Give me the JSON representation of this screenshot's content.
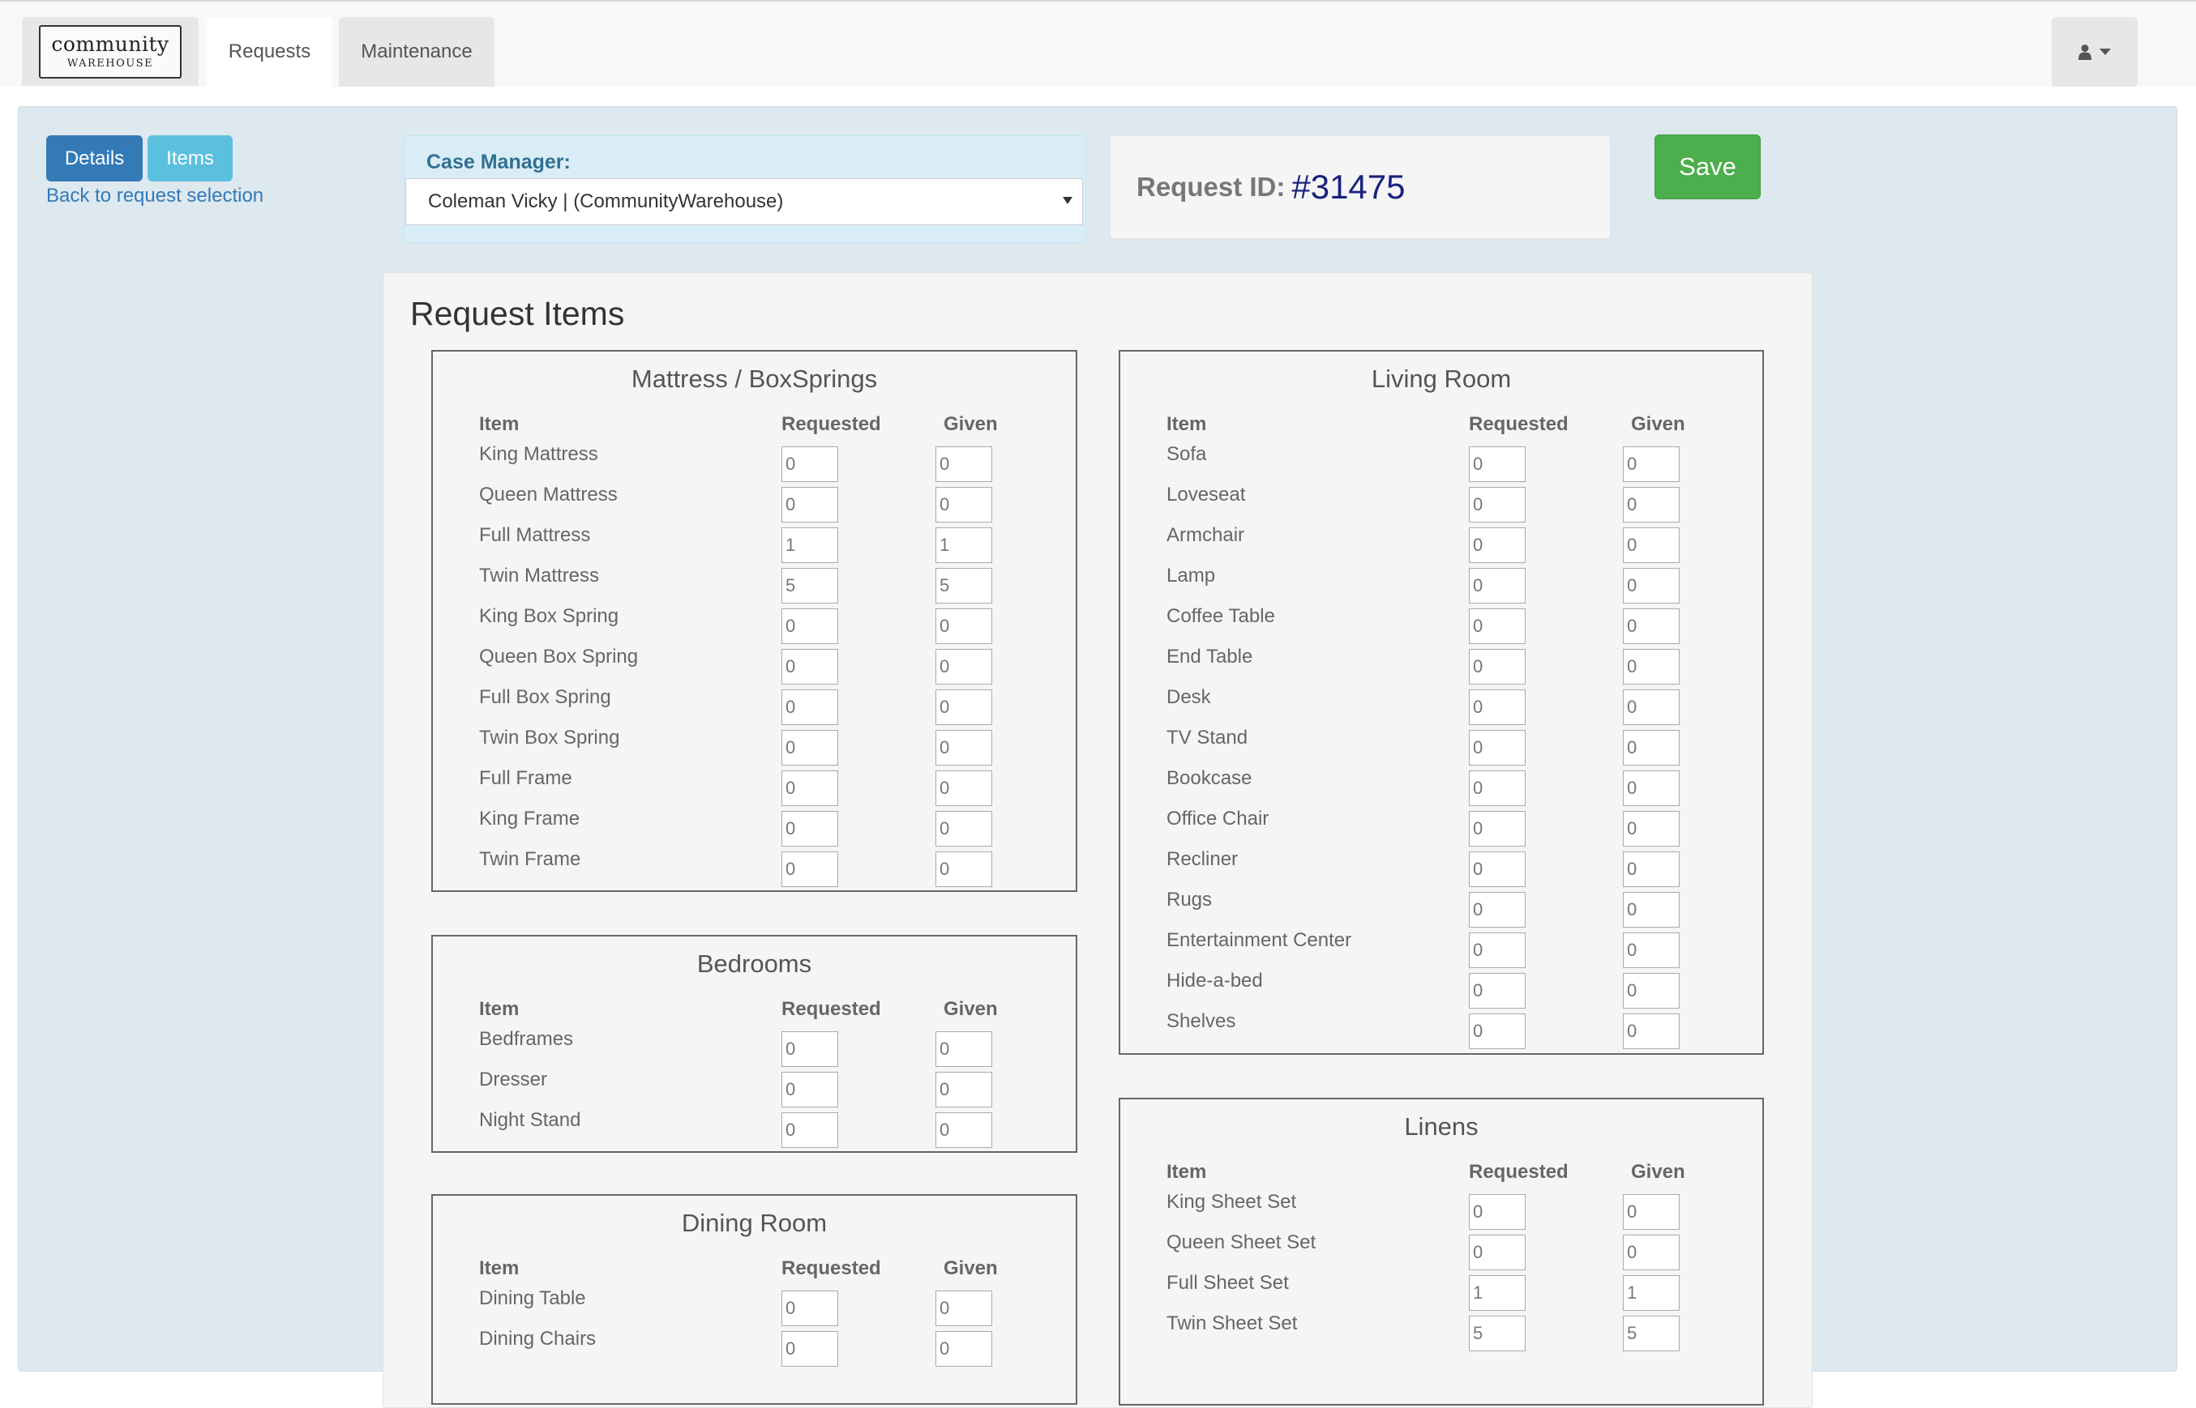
{
  "brand": {
    "logo_line1": "community",
    "logo_line2": "warehouse"
  },
  "nav": {
    "tabs": [
      {
        "label": "Requests"
      },
      {
        "label": "Maintenance"
      }
    ],
    "user_icon": "user-icon",
    "caret_icon": "caret-down-icon"
  },
  "subnav": {
    "details_label": "Details",
    "items_label": "Items",
    "back_link": "Back to request selection"
  },
  "case_manager": {
    "label": "Case Manager:",
    "selected": "Coleman Vicky | (CommunityWarehouse)"
  },
  "request": {
    "id_label": "Request ID:",
    "id_value": "#31475"
  },
  "save_label": "Save",
  "items_title": "Request Items",
  "columns": {
    "item": "Item",
    "requested": "Requested",
    "given": "Given"
  },
  "colors": {
    "primary": "#337ab7",
    "info": "#5bc0de",
    "success": "#4cae4c",
    "panel": "#dde8ef",
    "request_id": "#1a237e"
  },
  "categories": [
    {
      "title": "Mattress / BoxSprings",
      "rows": [
        {
          "name": "King Mattress",
          "requested": "0",
          "given": "0"
        },
        {
          "name": "Queen Mattress",
          "requested": "0",
          "given": "0"
        },
        {
          "name": "Full Mattress",
          "requested": "1",
          "given": "1"
        },
        {
          "name": "Twin Mattress",
          "requested": "5",
          "given": "5"
        },
        {
          "name": "King Box Spring",
          "requested": "0",
          "given": "0"
        },
        {
          "name": "Queen Box Spring",
          "requested": "0",
          "given": "0"
        },
        {
          "name": "Full Box Spring",
          "requested": "0",
          "given": "0"
        },
        {
          "name": "Twin Box Spring",
          "requested": "0",
          "given": "0"
        },
        {
          "name": "Full Frame",
          "requested": "0",
          "given": "0"
        },
        {
          "name": "King Frame",
          "requested": "0",
          "given": "0"
        },
        {
          "name": "Twin Frame",
          "requested": "0",
          "given": "0"
        }
      ]
    },
    {
      "title": "Bedrooms",
      "rows": [
        {
          "name": "Bedframes",
          "requested": "0",
          "given": "0"
        },
        {
          "name": "Dresser",
          "requested": "0",
          "given": "0"
        },
        {
          "name": "Night Stand",
          "requested": "0",
          "given": "0"
        }
      ]
    },
    {
      "title": "Dining Room",
      "rows": [
        {
          "name": "Dining Table",
          "requested": "0",
          "given": "0"
        },
        {
          "name": "Dining Chairs",
          "requested": "0",
          "given": "0"
        }
      ]
    },
    {
      "title": "Living Room",
      "rows": [
        {
          "name": "Sofa",
          "requested": "0",
          "given": "0"
        },
        {
          "name": "Loveseat",
          "requested": "0",
          "given": "0"
        },
        {
          "name": "Armchair",
          "requested": "0",
          "given": "0"
        },
        {
          "name": "Lamp",
          "requested": "0",
          "given": "0"
        },
        {
          "name": "Coffee Table",
          "requested": "0",
          "given": "0"
        },
        {
          "name": "End Table",
          "requested": "0",
          "given": "0"
        },
        {
          "name": "Desk",
          "requested": "0",
          "given": "0"
        },
        {
          "name": "TV Stand",
          "requested": "0",
          "given": "0"
        },
        {
          "name": "Bookcase",
          "requested": "0",
          "given": "0"
        },
        {
          "name": "Office Chair",
          "requested": "0",
          "given": "0"
        },
        {
          "name": "Recliner",
          "requested": "0",
          "given": "0"
        },
        {
          "name": "Rugs",
          "requested": "0",
          "given": "0"
        },
        {
          "name": "Entertainment Center",
          "requested": "0",
          "given": "0"
        },
        {
          "name": "Hide-a-bed",
          "requested": "0",
          "given": "0"
        },
        {
          "name": "Shelves",
          "requested": "0",
          "given": "0"
        }
      ]
    },
    {
      "title": "Linens",
      "rows": [
        {
          "name": "King Sheet Set",
          "requested": "0",
          "given": "0"
        },
        {
          "name": "Queen Sheet Set",
          "requested": "0",
          "given": "0"
        },
        {
          "name": "Full Sheet Set",
          "requested": "1",
          "given": "1"
        },
        {
          "name": "Twin Sheet Set",
          "requested": "5",
          "given": "5"
        }
      ]
    }
  ]
}
